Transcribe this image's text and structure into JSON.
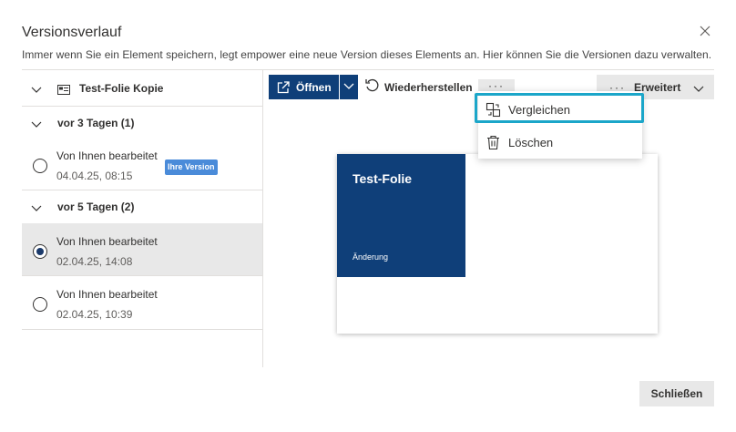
{
  "dialog": {
    "title": "Versionsverlauf",
    "description": "Immer wenn Sie ein Element speichern, legt empower eine neue Version dieses Elements an. Hier können Sie die Versionen dazu verwalten.",
    "close_icon": "close-icon",
    "close_button_label": "Schließen"
  },
  "sidebar": {
    "document_title": "Test-Folie Kopie",
    "document_icon": "presentation-icon",
    "groups": [
      {
        "label": "vor 3 Tagen (1)",
        "versions": [
          {
            "editor": "Von Ihnen bearbeitet",
            "date": "04.04.25, 08:15",
            "badge": "Ihre Version",
            "selected": false
          }
        ]
      },
      {
        "label": "vor 5 Tagen (2)",
        "versions": [
          {
            "editor": "Von Ihnen bearbeitet",
            "date": "02.04.25, 14:08",
            "selected": true
          },
          {
            "editor": "Von Ihnen bearbeitet",
            "date": "02.04.25, 10:39",
            "selected": false
          }
        ]
      }
    ]
  },
  "toolbar": {
    "open_label": "Öffnen",
    "open_icon": "open-external-icon",
    "restore_label": "Wiederherstellen",
    "restore_icon": "restore-icon",
    "more_label": "···",
    "advanced_dots": "···",
    "advanced_label": "Erweitert"
  },
  "menu": {
    "items": [
      {
        "label": "Vergleichen",
        "icon": "compare-icon",
        "focused": true
      },
      {
        "label": "Löschen",
        "icon": "trash-icon",
        "focused": false
      }
    ]
  },
  "preview": {
    "slide_title": "Test-Folie",
    "slide_subtitle": "Änderung"
  },
  "colors": {
    "accent": "#0f3f79",
    "focus": "#1ba6c9",
    "badge": "#4a8bd9",
    "selected_row": "#e8e8e8"
  }
}
